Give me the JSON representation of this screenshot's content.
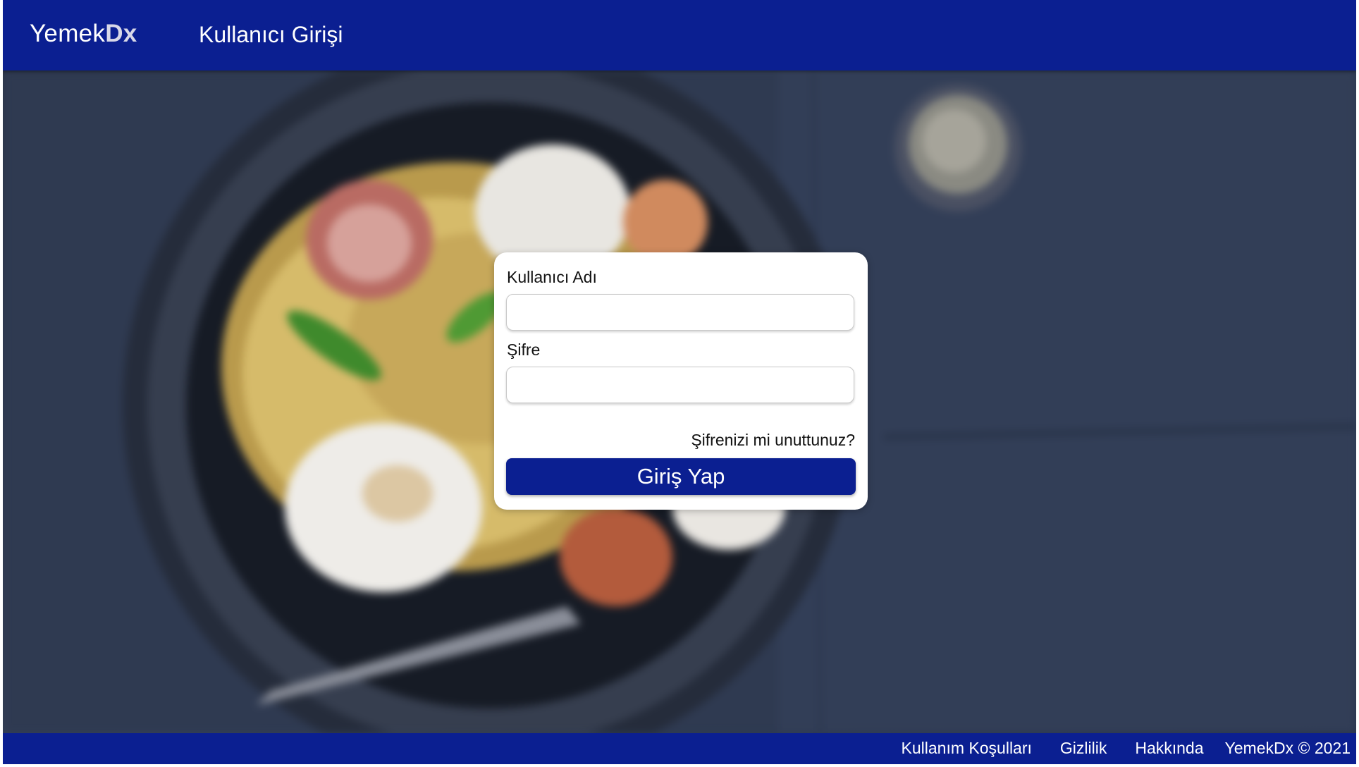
{
  "header": {
    "brand_light": "Yemek",
    "brand_bold": "Dx",
    "title": "Kullanıcı Girişi"
  },
  "login": {
    "username_label": "Kullanıcı Adı",
    "username_value": "",
    "password_label": "Şifre",
    "password_value": "",
    "forgot_link": "Şifrenizi mi unuttunuz?",
    "submit_label": "Giriş Yap"
  },
  "footer": {
    "links": [
      "Kullanım Koşulları",
      "Gizlilik",
      "Hakkında"
    ],
    "copyright": "YemekDx © 2021"
  },
  "colors": {
    "brand_blue": "#0b1f91",
    "card_bg": "#ffffff"
  },
  "background": {
    "subject": "blurred-pasta-plate-photo"
  }
}
